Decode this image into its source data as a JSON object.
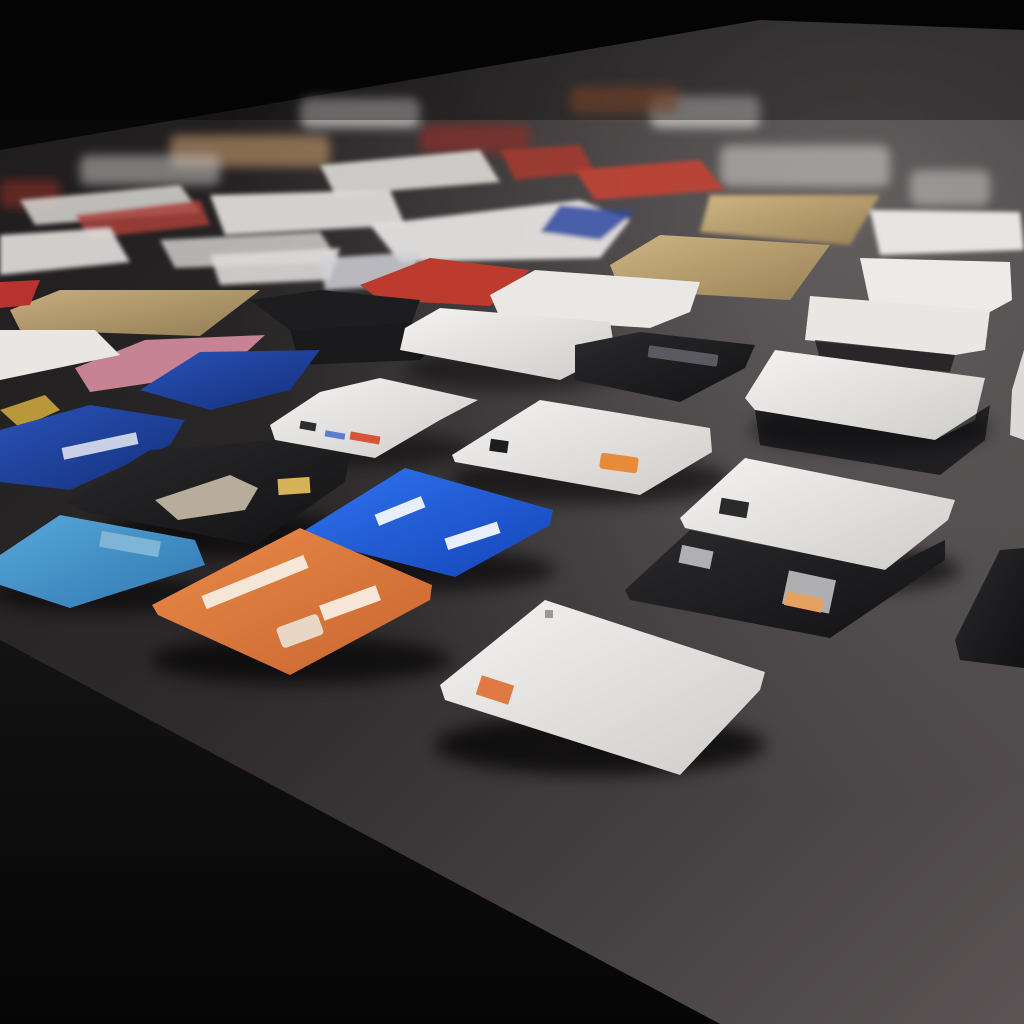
{
  "scene": {
    "description_hidden": "",
    "palette": {
      "background": "#0b0b0c",
      "table_top": "#2e2b2b",
      "table_light": "#4a4646",
      "table_edge": "#121112",
      "card_white": "#e9e8e6",
      "card_black": "#1b1b1d",
      "card_blue": "#1e5fe0",
      "card_navy": "#1c3f9a",
      "card_orange": "#e07a3a",
      "card_teal": "#3d8fc4",
      "card_gold": "#b39a66",
      "card_red": "#a8352d",
      "chip_gold": "#c9b27a",
      "accent_orange": "#e07038"
    },
    "cards": [
      {
        "name": "card-white-front-center",
        "kind": "white"
      },
      {
        "name": "card-orange-front-left",
        "kind": "orange"
      },
      {
        "name": "card-blue-center",
        "kind": "blue"
      },
      {
        "name": "card-teal-left",
        "kind": "teal"
      },
      {
        "name": "card-black-chip-left",
        "kind": "black"
      },
      {
        "name": "card-navy-left",
        "kind": "navy"
      },
      {
        "name": "card-white-center",
        "kind": "white"
      },
      {
        "name": "card-white-small-left",
        "kind": "white"
      },
      {
        "name": "card-white-right-top",
        "kind": "white"
      },
      {
        "name": "card-black-right",
        "kind": "black"
      },
      {
        "name": "card-white-right-mid",
        "kind": "white"
      },
      {
        "name": "card-gold-back",
        "kind": "gold"
      },
      {
        "name": "card-red-back",
        "kind": "red"
      }
    ]
  }
}
